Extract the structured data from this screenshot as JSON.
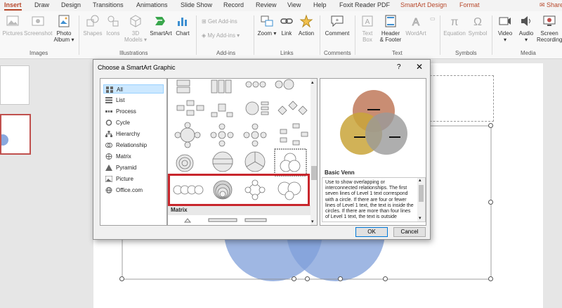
{
  "ribbon": {
    "tabs": [
      {
        "label": "Insert",
        "active": true
      },
      {
        "label": "Draw"
      },
      {
        "label": "Design"
      },
      {
        "label": "Transitions"
      },
      {
        "label": "Animations"
      },
      {
        "label": "Slide Show"
      },
      {
        "label": "Record"
      },
      {
        "label": "Review"
      },
      {
        "label": "View"
      },
      {
        "label": "Help"
      },
      {
        "label": "Foxit Reader PDF"
      },
      {
        "label": "SmartArt Design",
        "contextual": true
      },
      {
        "label": "Format",
        "contextual": true
      },
      {
        "label": "Share"
      }
    ],
    "buttons": {
      "pictures": "Pictures",
      "screenshot": "Screenshot",
      "photo_album_1": "Photo",
      "photo_album_2": "Album",
      "shapes": "Shapes",
      "icons": "Icons",
      "models_1": "3D",
      "models_2": "Models",
      "smartart": "SmartArt",
      "chart": "Chart",
      "get_addins": "Get Add-ins",
      "my_addins": "My Add-ins",
      "zoom": "Zoom",
      "link": "Link",
      "action": "Action",
      "comment": "Comment",
      "textbox_1": "Text",
      "textbox_2": "Box",
      "header_footer_1": "Header",
      "header_footer_2": "& Footer",
      "wordart": "WordArt",
      "equation": "Equation",
      "symbol": "Symbol",
      "video": "Video",
      "audio": "Audio",
      "screen_recording_1": "Screen",
      "screen_recording_2": "Recording"
    },
    "groups": {
      "images": "Images",
      "illustrations": "Illustrations",
      "addins": "Add-ins",
      "links": "Links",
      "comments": "Comments",
      "text": "Text",
      "symbols": "Symbols",
      "media": "Media"
    }
  },
  "dialog": {
    "title": "Choose a SmartArt Graphic",
    "help": "?",
    "close": "✕",
    "categories": [
      {
        "label": "All",
        "icon": "grid-icon",
        "selected": true
      },
      {
        "label": "List",
        "icon": "list-icon"
      },
      {
        "label": "Process",
        "icon": "process-icon"
      },
      {
        "label": "Cycle",
        "icon": "cycle-icon"
      },
      {
        "label": "Hierarchy",
        "icon": "hierarchy-icon"
      },
      {
        "label": "Relationship",
        "icon": "relationship-icon"
      },
      {
        "label": "Matrix",
        "icon": "matrix-icon"
      },
      {
        "label": "Pyramid",
        "icon": "pyramid-icon"
      },
      {
        "label": "Picture",
        "icon": "picture-icon"
      },
      {
        "label": "Office.com",
        "icon": "globe-icon"
      }
    ],
    "gallery_section": "Matrix",
    "preview": {
      "name": "Basic Venn",
      "description": "Use to show overlapping or interconnected relationships. The first seven lines of Level 1 text correspond with a circle. If there are four or fewer lines of Level 1 text, the text is inside the circles. If there are more than four lines of Level 1 text, the text is outside"
    },
    "ok": "OK",
    "cancel": "Cancel"
  },
  "colors": {
    "accent": "#b7472a",
    "highlight": "#c8262c",
    "venn_orange": "#c0795a",
    "venn_yellow": "#c9a43a",
    "venn_gray": "#9a9a9a",
    "slide_circle": "#7f9fd9"
  }
}
